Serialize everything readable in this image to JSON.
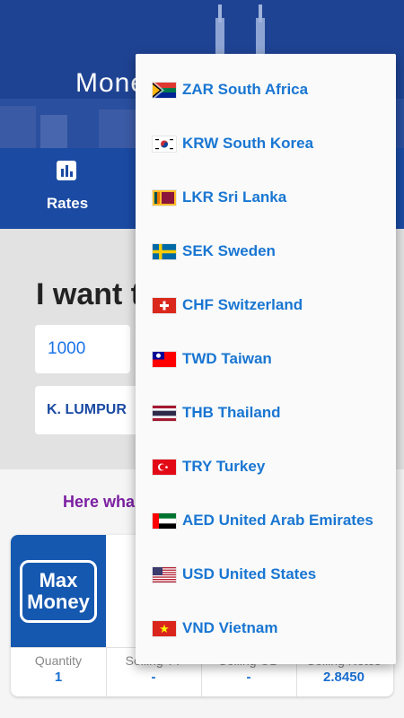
{
  "header": {
    "app_title": "Mone"
  },
  "nav": {
    "tab_rates": "Rates"
  },
  "form": {
    "heading": "I want t",
    "amount_value": "1000",
    "location_value": "K. LUMPUR"
  },
  "results": {
    "heading": "Here wha",
    "card": {
      "logo_line1": "Max",
      "logo_line2": "Money",
      "columns": [
        {
          "header": "Quantity",
          "value": "1"
        },
        {
          "header": "Selling TT",
          "value": "-"
        },
        {
          "header": "Selling OD",
          "value": "-"
        },
        {
          "header": "Selling Notes",
          "value": "2.8450"
        }
      ]
    }
  },
  "dropdown": {
    "options": [
      {
        "label": "ZAR South Africa",
        "flag": "za-flag-icon"
      },
      {
        "label": "KRW South Korea",
        "flag": "kr-flag-icon"
      },
      {
        "label": "LKR Sri Lanka",
        "flag": "lk-flag-icon"
      },
      {
        "label": "SEK Sweden",
        "flag": "se-flag-icon"
      },
      {
        "label": "CHF Switzerland",
        "flag": "ch-flag-icon"
      },
      {
        "label": "TWD Taiwan",
        "flag": "tw-flag-icon"
      },
      {
        "label": "THB Thailand",
        "flag": "th-flag-icon"
      },
      {
        "label": "TRY Turkey",
        "flag": "tr-flag-icon"
      },
      {
        "label": "AED United Arab Emirates",
        "flag": "ae-flag-icon"
      },
      {
        "label": "USD United States",
        "flag": "us-flag-icon"
      },
      {
        "label": "VND Vietnam",
        "flag": "vn-flag-icon"
      }
    ]
  },
  "colors": {
    "accent": "#1976d2",
    "header": "#1b4aa3",
    "purple": "#7b1fa2"
  }
}
